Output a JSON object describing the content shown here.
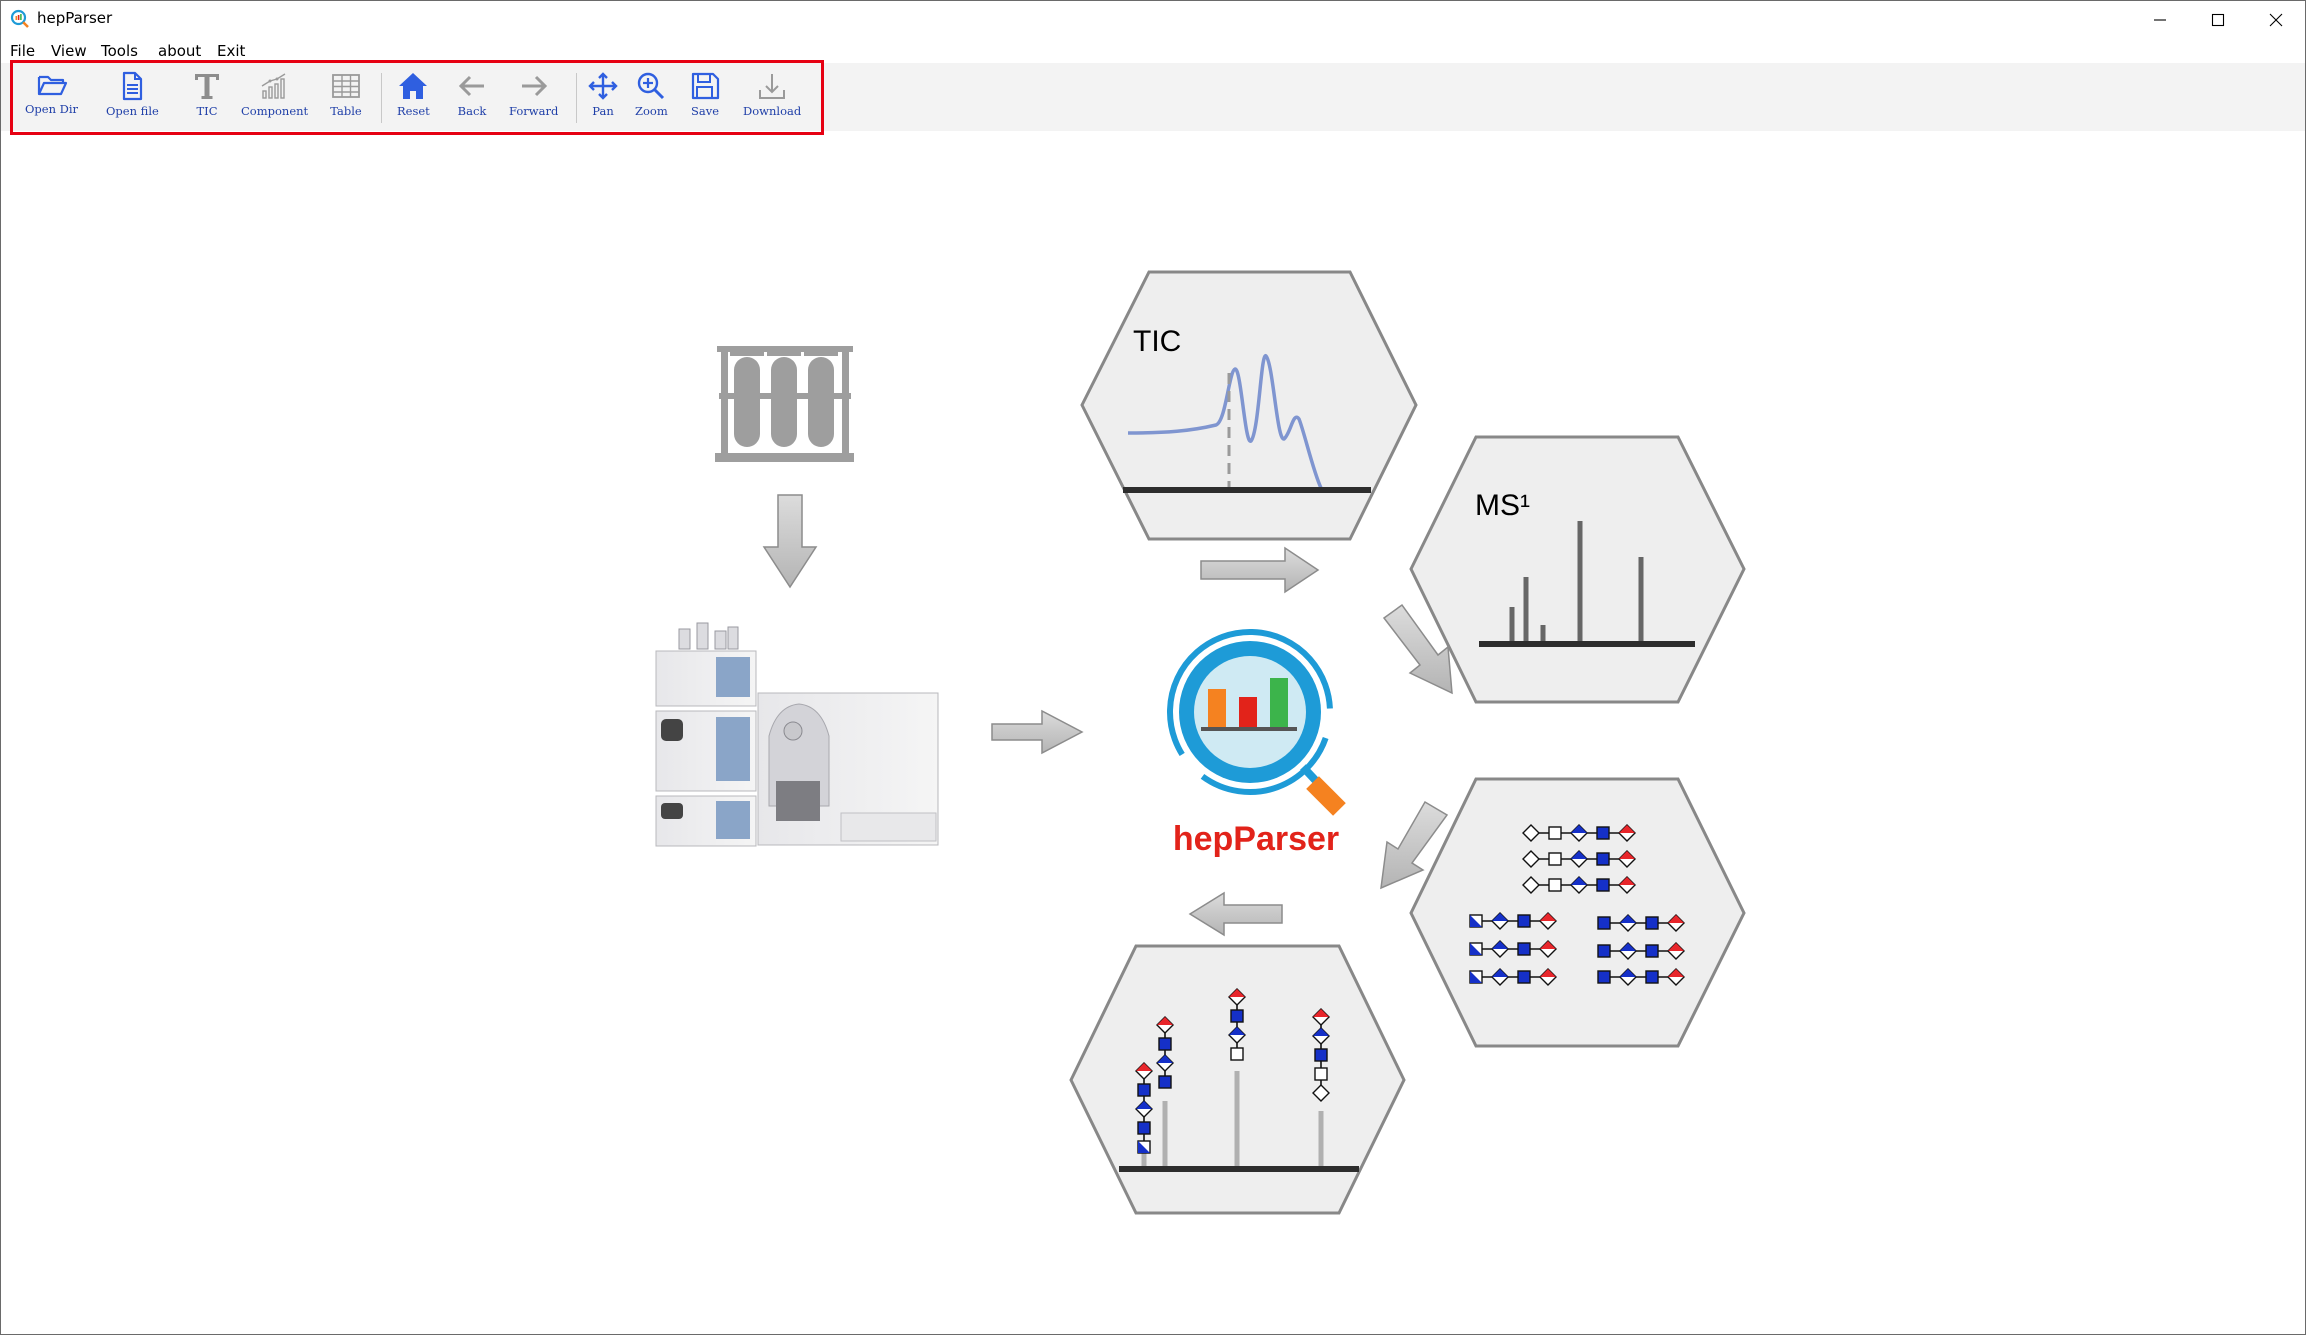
{
  "window": {
    "title": "hepParser"
  },
  "menu": [
    "File",
    "View",
    "Tools",
    "about",
    "Exit"
  ],
  "toolbar": [
    {
      "id": "open-dir",
      "label": "Open Dir",
      "icon": "folder-open-icon"
    },
    {
      "id": "open-file",
      "label": "Open file",
      "icon": "file-icon"
    },
    {
      "id": "tic",
      "label": "TIC",
      "icon": "text-t-icon"
    },
    {
      "id": "component",
      "label": "Component",
      "icon": "bar-chart-icon"
    },
    {
      "id": "table",
      "label": "Table",
      "icon": "table-icon"
    },
    {
      "id": "reset",
      "label": "Reset",
      "icon": "home-icon"
    },
    {
      "id": "back",
      "label": "Back",
      "icon": "arrow-left-icon"
    },
    {
      "id": "forward",
      "label": "Forward",
      "icon": "arrow-right-icon"
    },
    {
      "id": "pan",
      "label": "Pan",
      "icon": "move-icon"
    },
    {
      "id": "zoom",
      "label": "Zoom",
      "icon": "zoom-in-icon"
    },
    {
      "id": "save",
      "label": "Save",
      "icon": "save-icon"
    },
    {
      "id": "download",
      "label": "Download",
      "icon": "download-icon"
    }
  ],
  "workflow": {
    "brand": "hepParser",
    "tic_label": "TIC",
    "ms_label": "MS¹"
  },
  "colors": {
    "toolbar_active": "#2f5fe0",
    "toolbar_inactive": "#9a9a9a",
    "highlight_frame": "#e60012",
    "brand_red": "#e2231a",
    "hex_fill": "#eeeeee",
    "glycan_blue": "#1530c8",
    "glycan_red": "#e8262b"
  }
}
